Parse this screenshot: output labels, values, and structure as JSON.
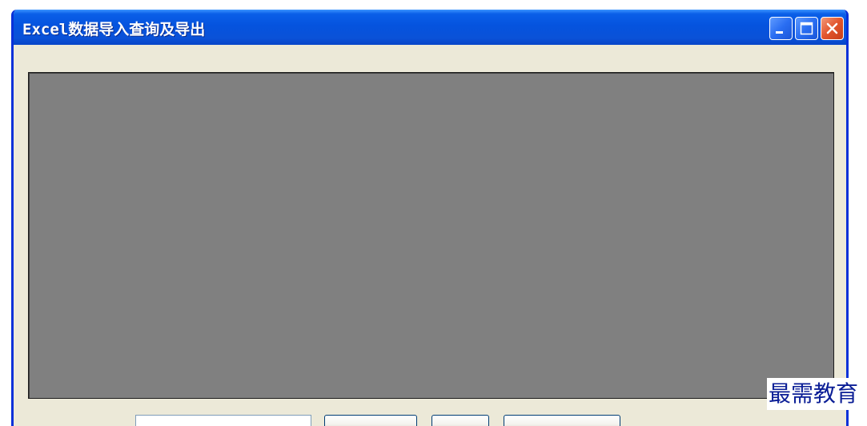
{
  "window": {
    "title": "Excel数据导入查询及导出",
    "controls": {
      "minimize_icon": "minimize-icon",
      "maximize_icon": "maximize-icon",
      "close_icon": "close-icon"
    }
  },
  "watermark": {
    "text": "最需教育"
  },
  "colors": {
    "titlebar": "#0553de",
    "window_body": "#ece9d8",
    "grid_background": "#808080",
    "close_button": "#e2542c",
    "watermark": "#0b1e96"
  }
}
